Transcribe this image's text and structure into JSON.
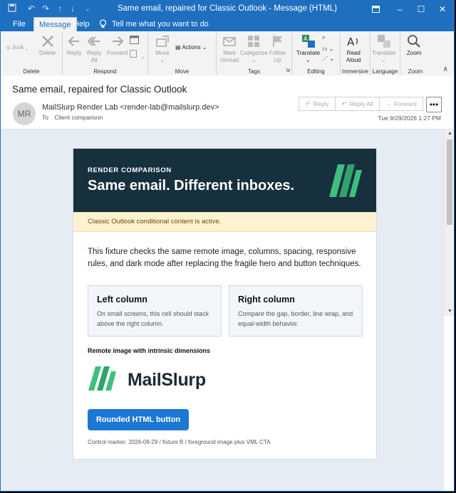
{
  "titlebar": {
    "title": "Same email, repaired for Classic Outlook - Message (HTML)",
    "save_icon": "save-icon",
    "undo_icon": "undo-icon",
    "redo_icon": "redo-icon",
    "up_icon": "arrow-up-icon",
    "down_icon": "arrow-down-icon",
    "customize_icon": "chevron-down-icon",
    "ribbon_options_icon": "ribbon-display-icon",
    "minimize": "–",
    "maximize": "☐",
    "close": "✕"
  },
  "menubar": {
    "tabs": [
      "File",
      "Message",
      "Help"
    ],
    "active_tab": "Message",
    "tell_me": "Tell me what you want to do"
  },
  "ribbon": {
    "groups": [
      {
        "label": "Delete",
        "buttons": [
          "Junk",
          "Delete"
        ]
      },
      {
        "label": "Respond",
        "buttons": [
          "Reply",
          "Reply\nAll",
          "Forward"
        ]
      },
      {
        "label": "Move",
        "buttons": [
          "Move",
          "Actions"
        ]
      },
      {
        "label": "Tags",
        "buttons": [
          "Mark\nUnread",
          "Categorize",
          "Follow\nUp"
        ]
      },
      {
        "label": "Editing",
        "buttons": [
          "Translate"
        ]
      },
      {
        "label": "Immersive",
        "buttons": [
          "Read\nAloud"
        ]
      },
      {
        "label": "Language",
        "buttons": [
          "Translate"
        ]
      },
      {
        "label": "Zoom",
        "buttons": [
          "Zoom"
        ]
      }
    ],
    "junk": "Junk",
    "delete": "Delete",
    "reply": "Reply",
    "reply_all_1": "Reply",
    "reply_all_2": "All",
    "forward": "Forward",
    "move": "Move",
    "actions": "Actions",
    "mark_1": "Mark",
    "mark_2": "Unread",
    "categorize": "Categorize",
    "follow_1": "Follow",
    "follow_2": "Up",
    "translate": "Translate",
    "read_1": "Read",
    "read_2": "Aloud",
    "translate2": "Translate",
    "zoom": "Zoom",
    "group_delete": "Delete",
    "group_respond": "Respond",
    "group_move": "Move",
    "group_tags": "Tags",
    "group_editing": "Editing",
    "group_immersive": "Immersive",
    "group_language": "Language",
    "group_zoom": "Zoom"
  },
  "message": {
    "subject": "Same email, repaired for Classic Outlook",
    "avatar_initials": "MR",
    "from": "MailSlurp Render Lab <render-lab@mailslurp.dev>",
    "to_label": "To",
    "to": "Client comparison",
    "date": "Tue 9/29/2026 1:27 PM",
    "actions": {
      "reply": "Reply",
      "reply_all": "Reply All",
      "forward": "Forward",
      "more": "•••"
    }
  },
  "email": {
    "eyebrow": "RENDER COMPARISON",
    "headline": "Same email. Different inboxes.",
    "notice": "Classic Outlook conditional content is active.",
    "intro": "This fixture checks the same remote image, columns, spacing, responsive rules, and dark mode after replacing the fragile hero and button techniques.",
    "left_col": {
      "title": "Left column",
      "text": "On small screens, this cell should stack above the right column."
    },
    "right_col": {
      "title": "Right column",
      "text": "Compare the gap, border, line wrap, and equal-width behavior."
    },
    "image_heading": "Remote image with intrinsic dimensions",
    "brand_name": "MailSlurp",
    "cta": "Rounded HTML button",
    "marker": "Control marker: 2026-09-29 / fixture B / foreground image plus VML CTA"
  },
  "colors": {
    "brand_blue": "#1e6fc0",
    "hero_bg": "#17303e",
    "logo_green": "#3fbf7f",
    "cta_blue": "#1c78d3",
    "notice_bg": "#fdf3d2"
  }
}
